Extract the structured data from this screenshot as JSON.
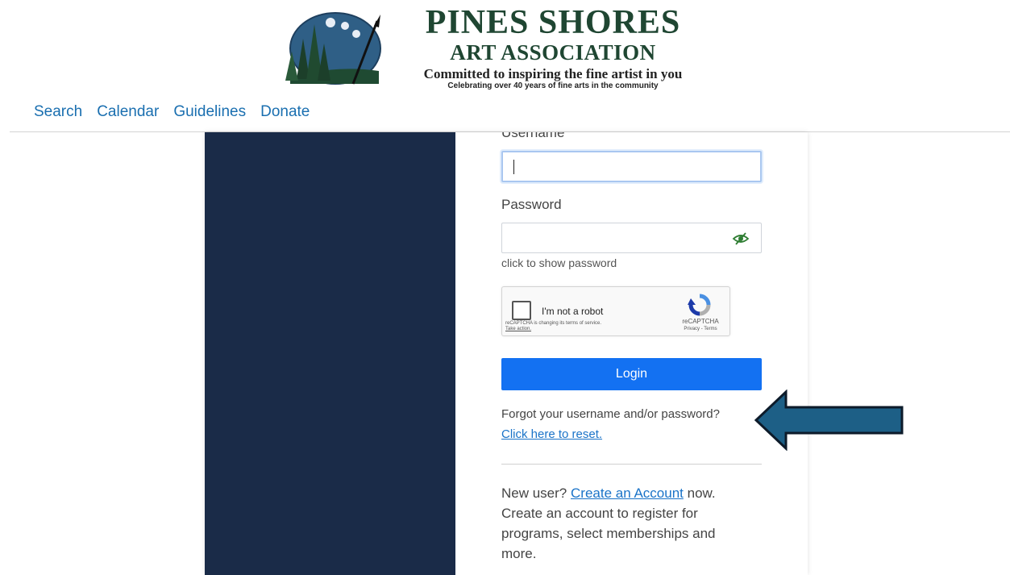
{
  "brand": {
    "name": "PINES SHORES",
    "subtitle": "ART ASSOCIATION",
    "tagline": "Committed to inspiring the fine artist in you",
    "small": "Celebrating over 40 years of fine arts in the community"
  },
  "nav": {
    "items": [
      "Search",
      "Calendar",
      "Guidelines",
      "Donate"
    ]
  },
  "form": {
    "username_label": "Username",
    "password_label": "Password",
    "password_hint": "click to show password",
    "login_label": "Login",
    "forgot_text": "Forgot your username and/or password?",
    "reset_link": "Click here to reset.",
    "new_user_prefix": "New user?",
    "create_account_link": "Create an Account",
    "new_user_suffix": "now.",
    "new_user_desc": "Create an account to register for programs, select memberships and more."
  },
  "captcha": {
    "label": "I'm not a robot",
    "notice": "reCAPTCHA is changing its terms of service.",
    "action": "Take action.",
    "brand": "reCAPTCHA",
    "links": "Privacy - Terms"
  },
  "icons": {
    "logo": "pines-palette-logo-icon",
    "eye": "eye-slash-icon",
    "recaptcha": "recaptcha-icon",
    "arrow": "left-arrow-icon"
  },
  "colors": {
    "brand_green": "#1f4632",
    "nav_link": "#1a6fb0",
    "dark_panel": "#1a2b48",
    "login_button": "#1371f2",
    "link": "#1a73c8",
    "arrow_fill": "#1d5f86",
    "arrow_stroke": "#0d1b2a"
  }
}
